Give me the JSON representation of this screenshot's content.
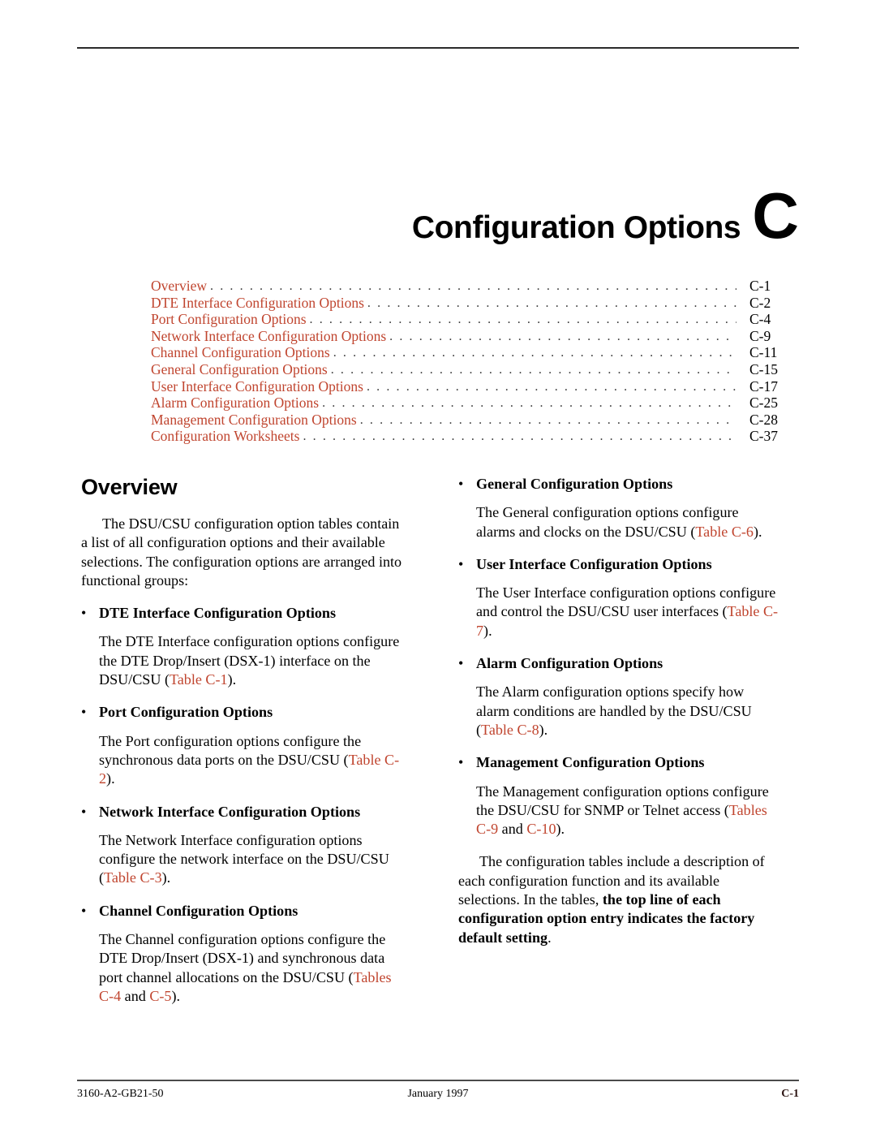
{
  "chapter": {
    "title": "Configuration Options",
    "letter": "C"
  },
  "toc": {
    "leader": ". . . . . . . . . . . . . . . . . . . . . . . . . . . . . . . . . . . . . . . . . . . . . . . . . . . . . . . . . . . . . . . . . . . . . . . . . . . . . . . . . . . . . . . . . . . . . . . . . . . . . . . . . . . . . . . . . . . . . . . . . . . . . . . . . . . . . . . . . . . . . . . . . . . . . . . . . . . . .",
    "entries": [
      {
        "label": "Overview",
        "page": "C-1"
      },
      {
        "label": "DTE Interface Configuration Options",
        "page": "C-2"
      },
      {
        "label": "Port Configuration Options",
        "page": "C-4"
      },
      {
        "label": "Network Interface Configuration Options",
        "page": "C-9"
      },
      {
        "label": "Channel Configuration Options",
        "page": "C-11"
      },
      {
        "label": "General Configuration Options",
        "page": "C-15"
      },
      {
        "label": "User Interface Configuration Options",
        "page": "C-17"
      },
      {
        "label": "Alarm Configuration Options",
        "page": "C-25"
      },
      {
        "label": "Management Configuration Options",
        "page": "C-28"
      },
      {
        "label": "Configuration Worksheets",
        "page": "C-37"
      }
    ]
  },
  "overview": {
    "heading": "Overview",
    "intro": "The DSU/CSU configuration option tables contain a list of all configuration options and their available selections. The configuration options are arranged into functional groups:"
  },
  "bullets": {
    "dot": "•",
    "left": [
      {
        "heading": "DTE Interface Configuration Options",
        "body_before": "The DTE Interface configuration options configure the DTE Drop/Insert (DSX-1) interface on the DSU/CSU (",
        "xref1": "Table C-1",
        "body_mid": "",
        "xref2": "",
        "body_after": ")."
      },
      {
        "heading": "Port Configuration Options",
        "body_before": "The Port configuration options configure the synchronous data ports on the DSU/CSU (",
        "xref1": "Table C-2",
        "body_mid": "",
        "xref2": "",
        "body_after": ")."
      },
      {
        "heading": "Network Interface Configuration Options",
        "body_before": "The Network Interface configuration options configure the network interface on the DSU/CSU (",
        "xref1": "Table C-3",
        "body_mid": "",
        "xref2": "",
        "body_after": ")."
      },
      {
        "heading": "Channel Configuration Options",
        "body_before": "The Channel configuration options configure the DTE Drop/Insert (DSX-1) and synchronous data port channel allocations on the DSU/CSU (",
        "xref1": "Tables C-4",
        "body_mid": " and ",
        "xref2": "C-5",
        "body_after": ")."
      }
    ],
    "right": [
      {
        "heading": "General Configuration Options",
        "body_before": "The General configuration options configure alarms and clocks on the DSU/CSU (",
        "xref1": "Table C-6",
        "body_mid": "",
        "xref2": "",
        "body_after": ")."
      },
      {
        "heading": "User Interface Configuration Options",
        "body_before": "The User Interface configuration options configure and control the DSU/CSU user interfaces (",
        "xref1": "Table C-7",
        "body_mid": "",
        "xref2": "",
        "body_after": ")."
      },
      {
        "heading": "Alarm Configuration Options",
        "body_before": "The Alarm configuration options specify how alarm conditions are handled by the DSU/CSU (",
        "xref1": "Table C-8",
        "body_mid": "",
        "xref2": "",
        "body_after": ")."
      },
      {
        "heading": "Management Configuration Options",
        "body_before": "The Management configuration options configure the DSU/CSU for SNMP or Telnet access (",
        "xref1": "Tables C-9",
        "body_mid": " and ",
        "xref2": "C-10",
        "body_after": ")."
      }
    ]
  },
  "closing": {
    "part1": "The configuration tables include a description of each configuration function and its available selections. In the tables, ",
    "emphasis": "the top line of each configuration option entry indicates the factory default setting",
    "part2": "."
  },
  "footer": {
    "document_number": "3160-A2-GB21-50",
    "date": "January 1997",
    "page_number": "C-1"
  },
  "colors": {
    "xref_red": "#c0452f",
    "rule_gray": "#2b2b2b"
  }
}
